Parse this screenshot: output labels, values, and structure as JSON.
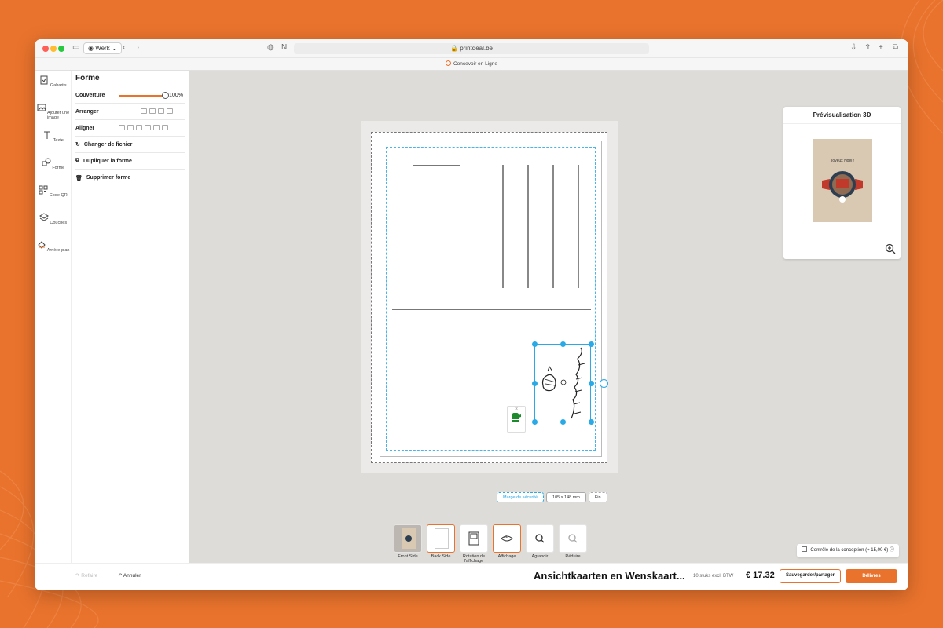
{
  "browser": {
    "profile": "Werk",
    "url": "printdeal.be",
    "tab_title": "Concevoir en Ligne"
  },
  "rail": [
    {
      "label": "Gabarits",
      "icon": "templates-icon"
    },
    {
      "label": "Ajouter une image",
      "icon": "image-icon"
    },
    {
      "label": "Texte",
      "icon": "text-icon"
    },
    {
      "label": "Forme",
      "icon": "shapes-icon"
    },
    {
      "label": "Code QR",
      "icon": "qr-code-icon"
    },
    {
      "label": "Couches",
      "icon": "layers-icon"
    },
    {
      "label": "Arrière-plan",
      "icon": "paint-bucket-icon"
    }
  ],
  "panel": {
    "title": "Forme",
    "coverage_label": "Couverture",
    "coverage_value": "100%",
    "coverage": 1.0,
    "arrange_label": "Arranger",
    "align_label": "Aligner",
    "change_file": "Changer de fichier",
    "duplicate": "Dupliquer la forme",
    "delete": "Supprimer forme"
  },
  "canvas": {
    "safety_margin": "Marge de sécurité",
    "dimensions": "105 x 148 mm",
    "fin": "Fin"
  },
  "preview": {
    "title": "Prévisualisation 3D",
    "card_text": "Joyeux Noël !"
  },
  "thumbs": [
    {
      "label": "Front Side"
    },
    {
      "label": "Back Side"
    },
    {
      "label": "Rotation de l'affichage"
    },
    {
      "label": "Affichage"
    },
    {
      "label": "Agrandir"
    },
    {
      "label": "Réduire"
    }
  ],
  "design_check": "Contrôle de la conception (+ 15,00 €)",
  "footer": {
    "redo": "Refaire",
    "undo": "Annuler",
    "product": "Ansichtkaarten en Wenskaart...",
    "quantity": "10 stuks excl. BTW",
    "price": "€ 17.32",
    "save": "Sauvegarder/partager",
    "deliver": "Délivres"
  },
  "colors": {
    "accent": "#e9732d",
    "selection": "#29a9e6"
  }
}
